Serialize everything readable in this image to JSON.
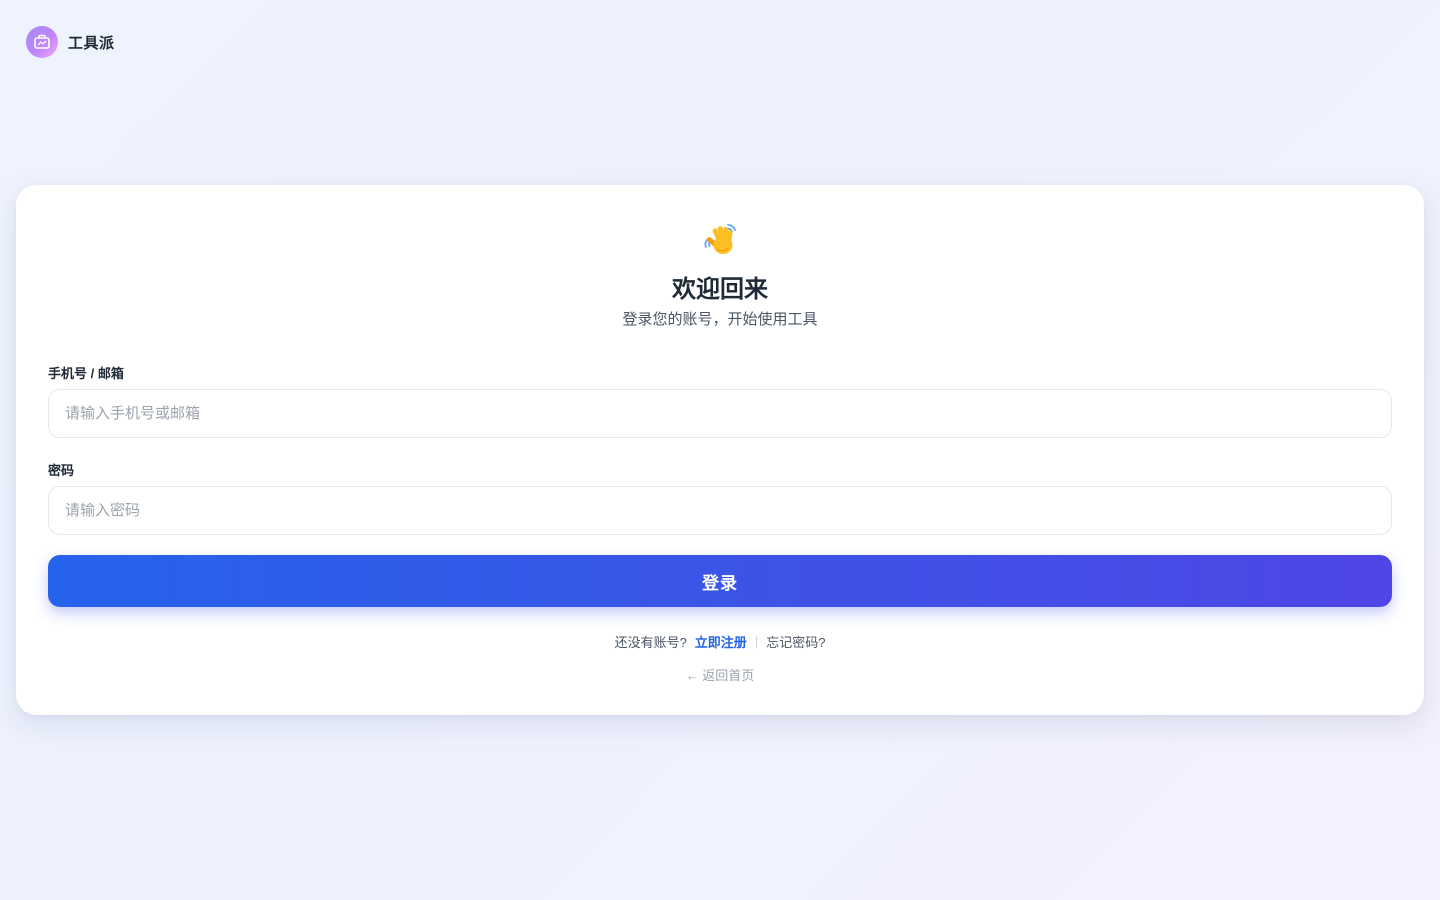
{
  "header": {
    "brand_name": "工具派",
    "logo_icon": "briefcase-icon"
  },
  "login": {
    "greeting_icon": "waving-hand-icon",
    "title": "欢迎回来",
    "subtitle": "登录您的账号，开始使用工具",
    "account_label": "手机号 / 邮箱",
    "account_placeholder": "请输入手机号或邮箱",
    "account_value": "",
    "password_label": "密码",
    "password_placeholder": "请输入密码",
    "password_value": "",
    "submit_label": "登录",
    "no_account_text": "还没有账号?",
    "register_link": "立即注册",
    "separator": "|",
    "forgot_link": "忘记密码?",
    "back_home_link": "← 返回首页"
  },
  "colors": {
    "accent": "#2563eb",
    "accent_end": "#4f46e5",
    "logo_gradient_start": "#a78bfa",
    "logo_gradient_end": "#f0abfc"
  }
}
